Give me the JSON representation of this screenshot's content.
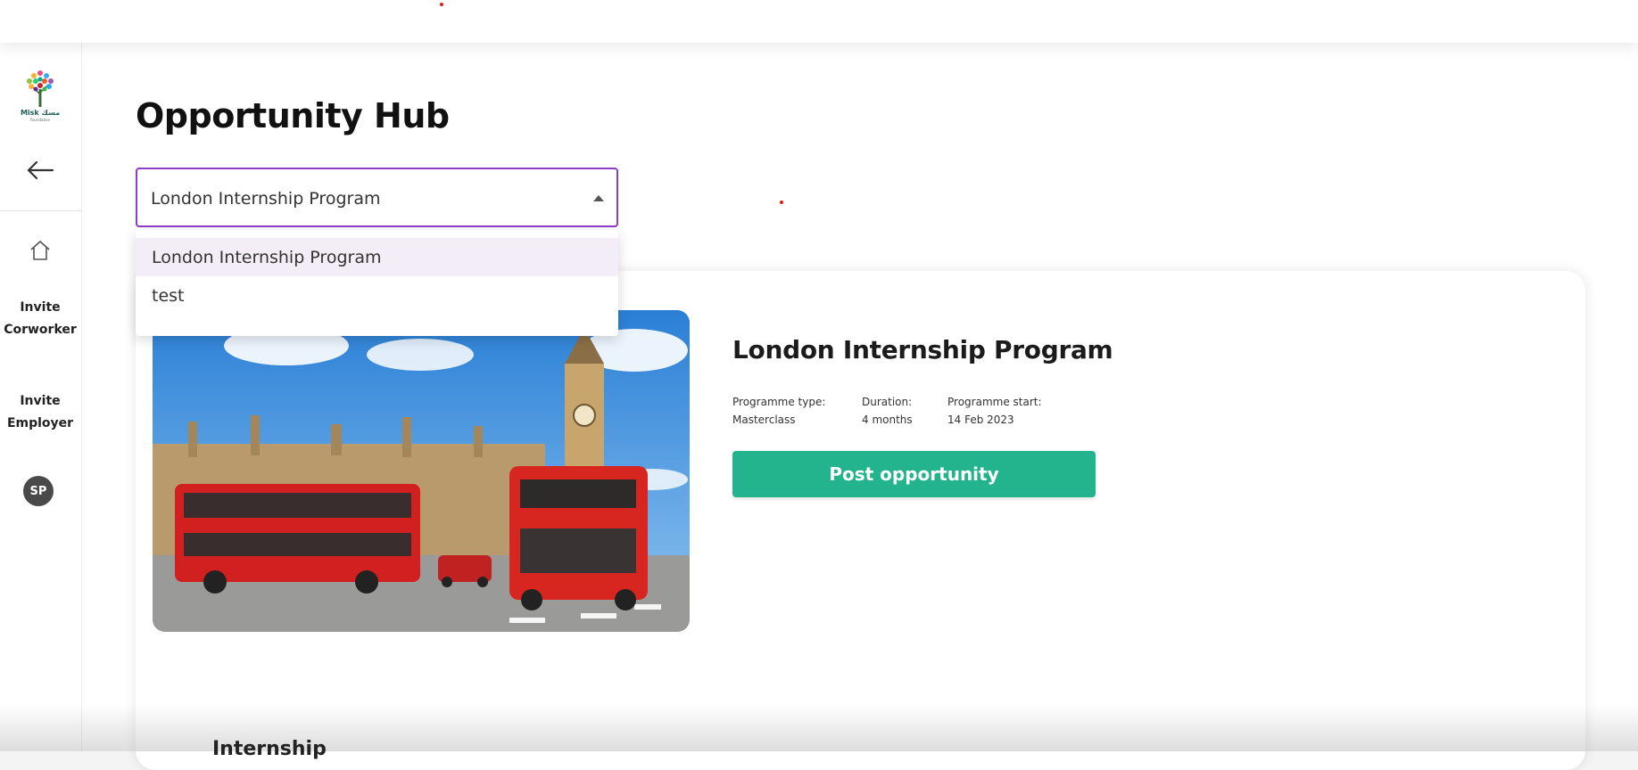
{
  "page": {
    "title": "Opportunity Hub"
  },
  "sidebar": {
    "logo_text": "Misk مسك",
    "logo_subtext": "Foundation",
    "items": [
      {
        "label_line1": "Invite",
        "label_line2": "Corworker"
      },
      {
        "label_line1": "Invite",
        "label_line2": "Employer"
      }
    ],
    "avatar_initials": "SP"
  },
  "program_select": {
    "value": "London Internship Program",
    "options": [
      "London Internship Program",
      "test"
    ]
  },
  "card": {
    "title": "London Internship Program",
    "image_alt": "London buses and Big Ben",
    "meta": [
      {
        "label": "Programme type:",
        "value": "Masterclass"
      },
      {
        "label": "Duration:",
        "value": "4 months"
      },
      {
        "label": "Programme start:",
        "value": "14 Feb 2023"
      }
    ],
    "post_button": "Post opportunity"
  },
  "bottom_peek_text": "Internship",
  "colors": {
    "accent_purple": "#8a3ec7",
    "button_green": "#23b48e"
  }
}
